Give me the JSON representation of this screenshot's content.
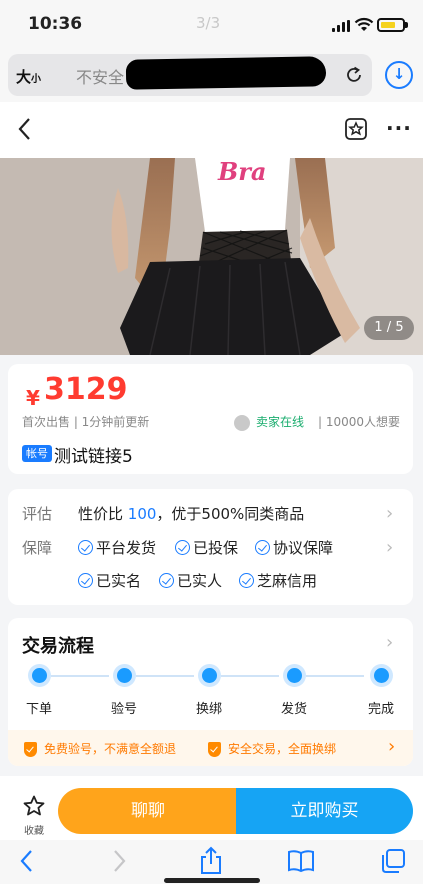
{
  "status": {
    "time": "10:36",
    "page_indicator": "3/3"
  },
  "urlbar": {
    "text_size_label": "大",
    "text_size_small": "小",
    "security_text": "不安全"
  },
  "gallery": {
    "counter": "1 / 5"
  },
  "product": {
    "currency": "¥",
    "price": "3129",
    "meta": "首次出售 | 1分钟前更新",
    "seller_status": "卖家在线",
    "want": "| 10000人想要",
    "tag": "帐号",
    "title": "测试链接5"
  },
  "guarantee": {
    "eval_label": "评估",
    "eval_prefix": "性价比 ",
    "eval_score": "100",
    "eval_suffix": "，优于500%同类商品",
    "guard_label": "保障",
    "items": [
      "平台发货",
      "已投保",
      "协议保障",
      "已实名",
      "已实人",
      "芝麻信用"
    ]
  },
  "flow": {
    "title": "交易流程",
    "steps": [
      "下单",
      "验号",
      "换绑",
      "发货",
      "完成"
    ],
    "notices": [
      "免费验号，不满意全额退",
      "安全交易，全面换绑"
    ]
  },
  "actions": {
    "collect": "收藏",
    "chat": "聊聊",
    "buy": "立即购买"
  },
  "colors": {
    "price": "#ff3b30",
    "accent": "#1a7cff",
    "chat": "#ffa41b",
    "buy": "#16a4f4",
    "seller_online": "#1aad6e",
    "notice": "#ff7a00"
  }
}
